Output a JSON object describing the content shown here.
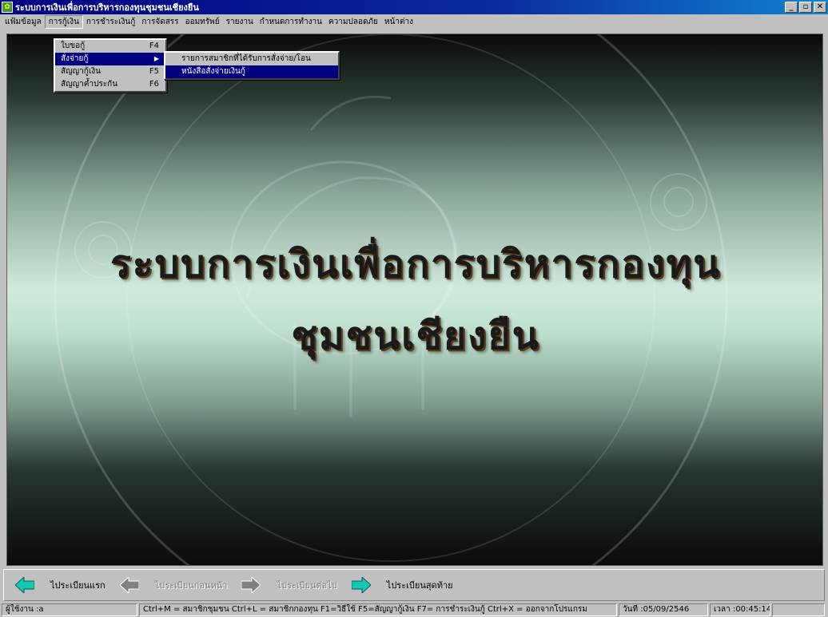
{
  "window": {
    "title": "ระบบการเงินเพื่อการบริหารกองทุนชุมชนเชียงยืน",
    "min_label": "_",
    "max_label": "▫",
    "close_label": "✕"
  },
  "menubar": {
    "items": [
      {
        "label": "แฟ้มข้อมูล"
      },
      {
        "label": "การกู้เงิน"
      },
      {
        "label": "การชำระเงินกู้"
      },
      {
        "label": "การจัดสรร"
      },
      {
        "label": "ออมทรัพย์"
      },
      {
        "label": "รายงาน"
      },
      {
        "label": "กำหนดการทำงาน"
      },
      {
        "label": "ความปลอดภัย"
      },
      {
        "label": "หน้าต่าง"
      }
    ]
  },
  "loan_menu": {
    "items": [
      {
        "label": "ใบขอกู้",
        "shortcut": "F4"
      },
      {
        "label": "สั่งจ่ายกู้",
        "shortcut": ""
      },
      {
        "label": "สัญญากู้เงิน",
        "shortcut": "F5"
      },
      {
        "label": "สัญญาค้ำประกัน",
        "shortcut": "F6"
      }
    ]
  },
  "pay_submenu": {
    "items": [
      {
        "label": "รายการสมาชิกที่ได้รับการสั่งจ่าย/โอน"
      },
      {
        "label": "หนังสือสั่งจ่ายเงินกู้"
      }
    ]
  },
  "splash": {
    "line1": "ระบบการเงินเพื่อการบริหารกองทุน",
    "line2": "ชุมชนเชียงยืน"
  },
  "navigation": {
    "first_label": "ไประเบียนแรก",
    "prev_label": "ไประเบียนก่อนหน้า",
    "next_label": "ไประเบียนต่อไป",
    "last_label": "ไประเบียนสุดท้าย"
  },
  "statusbar": {
    "user": "ผู้ใช้งาน :a",
    "shortcuts": "Ctrl+M = สมาชิกชุมชน   Ctrl+L = สมาชิกกองทุน   F1=วิธีใช้   F5=สัญญากู้เงิน   F7= การชำระเงินกู้   Ctrl+X = ออกจากโปรแกรม",
    "date": "วันที่ :05/09/2546",
    "time": "เวลา :00:45:14"
  },
  "colors": {
    "menu_highlight": "#000080",
    "arrow_green": "#14c8b4",
    "arrow_disabled": "#808080"
  }
}
